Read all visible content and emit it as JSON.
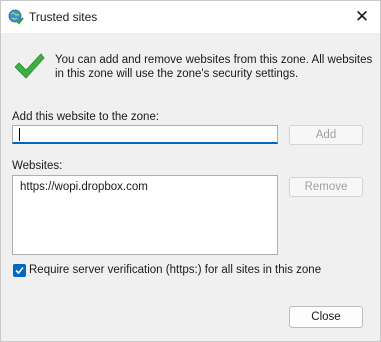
{
  "window": {
    "title": "Trusted sites",
    "title_icon": "globe-check-icon",
    "close_icon": "close-icon",
    "close_glyph": "✕"
  },
  "info": {
    "icon": "checkmark-icon",
    "text": "You can add and remove websites from this zone. All websites in this zone will use the zone's security settings."
  },
  "add_section": {
    "label": "Add this website to the zone:",
    "input_value": "",
    "add_button": "Add"
  },
  "websites_section": {
    "label": "Websites:",
    "items": [
      "https://wopi.dropbox.com"
    ],
    "remove_button": "Remove"
  },
  "require_https": {
    "label": "Require server verification (https:) for all sites in this zone",
    "checked": true
  },
  "footer": {
    "close_button": "Close"
  },
  "colors": {
    "accent": "#0067c0",
    "check_green": "#3cb043"
  }
}
